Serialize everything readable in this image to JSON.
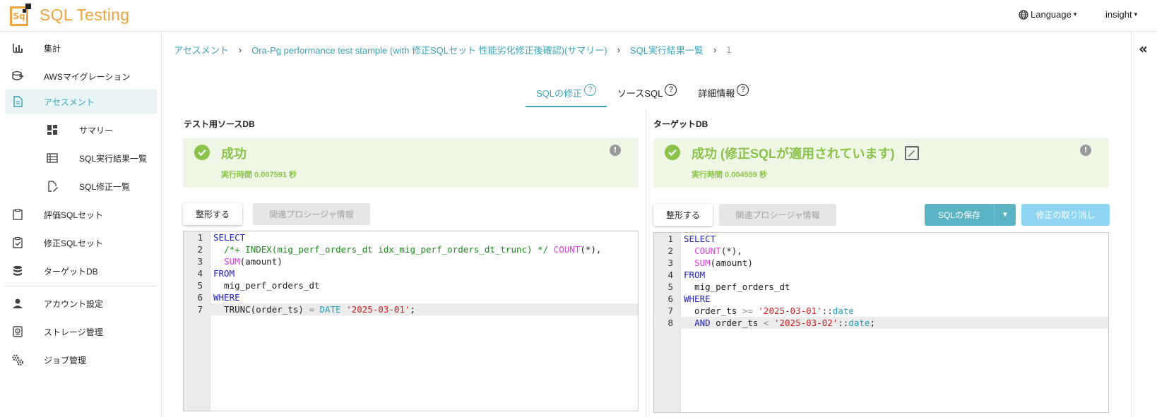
{
  "header": {
    "app_title": "SQL Testing",
    "logo_text": "Sq",
    "language_label": "Language",
    "user_label": "insight"
  },
  "sidebar": {
    "items": [
      {
        "label": "集計",
        "icon": "bar-chart-icon"
      },
      {
        "label": "AWSマイグレーション",
        "icon": "database-migrate-icon"
      },
      {
        "label": "アセスメント",
        "icon": "document-icon",
        "active": true
      },
      {
        "label": "サマリー",
        "icon": "dashboard-icon",
        "sub": true
      },
      {
        "label": "SQL実行結果一覧",
        "icon": "list-icon",
        "sub": true
      },
      {
        "label": "SQL修正一覧",
        "icon": "edit-document-icon",
        "sub": true
      },
      {
        "label": "評価SQLセット",
        "icon": "clipboard-icon"
      },
      {
        "label": "修正SQLセット",
        "icon": "clipboard-check-icon"
      },
      {
        "label": "ターゲットDB",
        "icon": "database-icon"
      },
      {
        "label": "アカウント設定",
        "icon": "person-icon"
      },
      {
        "label": "ストレージ管理",
        "icon": "storage-icon"
      },
      {
        "label": "ジョブ管理",
        "icon": "gears-icon"
      }
    ]
  },
  "breadcrumb": [
    "アセスメント",
    "Ora-Pg performance test stample (with 修正SQLセット 性能劣化修正後確認)(サマリー)",
    "SQL実行結果一覧",
    "1"
  ],
  "tabs": [
    {
      "label": "SQLの修正",
      "active": true
    },
    {
      "label": "ソースSQL",
      "active": false
    },
    {
      "label": "詳細情報",
      "active": false
    }
  ],
  "source_panel": {
    "title": "テスト用ソースDB",
    "status_title": "成功",
    "exec_time": "実行時間 0.007591 秒",
    "format_button": "整形する",
    "procedure_button": "関連プロシージャ情報"
  },
  "target_panel": {
    "title": "ターゲットDB",
    "status_title": "成功 (修正SQLが適用されています)",
    "exec_time": "実行時間 0.004559 秒",
    "format_button": "整形する",
    "procedure_button": "関連プロシージャ情報",
    "save_button": "SQLの保存",
    "cancel_fix_button": "修正の取り消し"
  },
  "colors": {
    "accent": "#3aa3b8",
    "brand": "#f0a23b",
    "success": "#8bc34a",
    "success_bg": "#eef6e6",
    "button_teal": "#5bb4c4",
    "button_light": "#8fd6f4"
  }
}
